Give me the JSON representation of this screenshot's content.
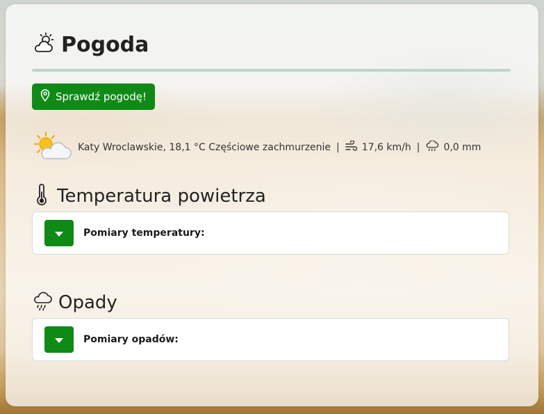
{
  "header": {
    "title": "Pogoda",
    "icon": "cloud-sun-icon"
  },
  "check_button": {
    "label": "Sprawdź pogodę!",
    "icon": "map-pin-icon"
  },
  "current": {
    "location_temp_desc": "Katy Wroclawskie, 18,1 °C Częściowe zachmurzenie",
    "separator": "|",
    "wind": "17,6 km/h",
    "rain": "0,0 mm",
    "weather_icon": "partly-cloudy-icon",
    "wind_icon": "wind-icon",
    "rain_icon": "cloud-drizzle-icon"
  },
  "temperature_section": {
    "title": "Temperatura powietrza",
    "icon": "thermometer-icon",
    "panel_label": "Pomiary temperatury:"
  },
  "precipitation_section": {
    "title": "Opady",
    "icon": "cloud-rain-icon",
    "panel_label": "Pomiary opadów:"
  },
  "colors": {
    "accent": "#0f8a17",
    "divider": "#b9d8c8"
  }
}
